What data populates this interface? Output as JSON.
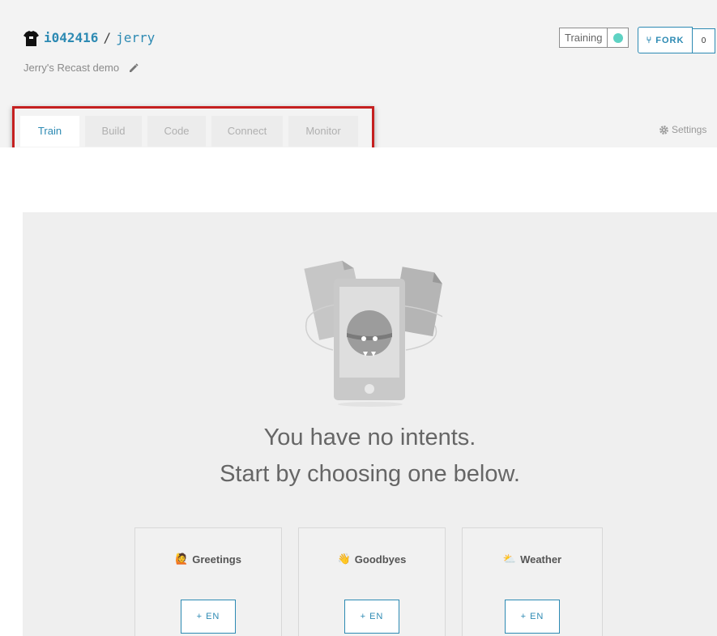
{
  "header": {
    "owner": "i042416",
    "separator": "/",
    "repo": "jerry",
    "description": "Jerry's Recast demo",
    "training_label": "Training",
    "fork_label": "FORK",
    "fork_icon": "⑂",
    "fork_count": "0"
  },
  "tabs": [
    {
      "label": "Train",
      "active": true
    },
    {
      "label": "Build",
      "active": false
    },
    {
      "label": "Code",
      "active": false
    },
    {
      "label": "Connect",
      "active": false
    },
    {
      "label": "Monitor",
      "active": false
    }
  ],
  "settings_label": "Settings",
  "empty_state": {
    "line1": "You have no intents.",
    "line2": "Start by choosing one below."
  },
  "cards": [
    {
      "emoji": "🙋",
      "title": "Greetings",
      "button": "+ EN"
    },
    {
      "emoji": "👋",
      "title": "Goodbyes",
      "button": "+ EN"
    },
    {
      "emoji": "⛅",
      "title": "Weather",
      "button": "+ EN"
    }
  ],
  "colors": {
    "accent": "#2d8ab3",
    "status": "#5ed2c3",
    "highlight": "#c52020"
  }
}
